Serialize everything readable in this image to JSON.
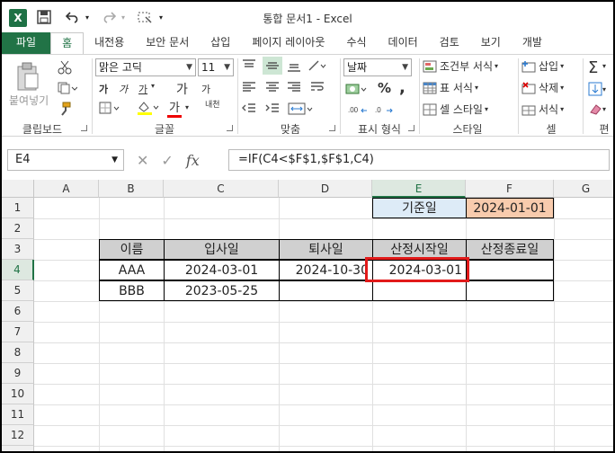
{
  "title": "통합 문서1 - Excel",
  "tabs": [
    "파일",
    "홈",
    "내전용",
    "보안 문서",
    "삽입",
    "페이지 레이아웃",
    "수식",
    "데이터",
    "검토",
    "보기",
    "개발"
  ],
  "ribbon": {
    "paste_label": "붙여넣기",
    "font_name": "맑은 고딕",
    "font_size": "11",
    "number_format": "날짜",
    "conditional_format": "조건부 서식",
    "table_format": "표 서식",
    "cell_style": "셀 스타일",
    "insert": "삽입",
    "delete": "삭제",
    "format": "서식",
    "groups": {
      "clipboard": "클립보드",
      "font": "글꼴",
      "align": "맞춤",
      "number": "표시 형식",
      "style": "스타일",
      "cells": "셀",
      "edit": "편"
    },
    "bold": "가",
    "italic": "가",
    "underline": "가",
    "grow_font": "가",
    "shrink_font": "가",
    "font_color_glyph": "가",
    "phonetic": "내천",
    "percent": "%",
    "comma": ","
  },
  "formula_bar": {
    "name_box": "E4",
    "formula": "=IF(C4<$F$1,$F$1,C4)"
  },
  "grid": {
    "columns": [
      "A",
      "B",
      "C",
      "D",
      "E",
      "F",
      "G"
    ],
    "rows": [
      "1",
      "2",
      "3",
      "4",
      "5",
      "6",
      "7",
      "8",
      "9",
      "10",
      "11",
      "12",
      "13"
    ],
    "cells": {
      "E1": "기준일",
      "F1": "2024-01-01",
      "B3": "이름",
      "C3": "입사일",
      "D3": "퇴사일",
      "E3": "산정시작일",
      "F3": "산정종료일",
      "B4": "AAA",
      "C4": "2024-03-01",
      "D4": "2024-10-30",
      "E4": "2024-03-01",
      "B5": "BBB",
      "C5": "2023-05-25"
    }
  },
  "colors": {
    "excel_green": "#217346",
    "e1_fill": "#ddebf7",
    "f1_fill": "#f8cbad",
    "header_fill": "#d0d0d0",
    "highlight_border": "#e21a1a"
  }
}
